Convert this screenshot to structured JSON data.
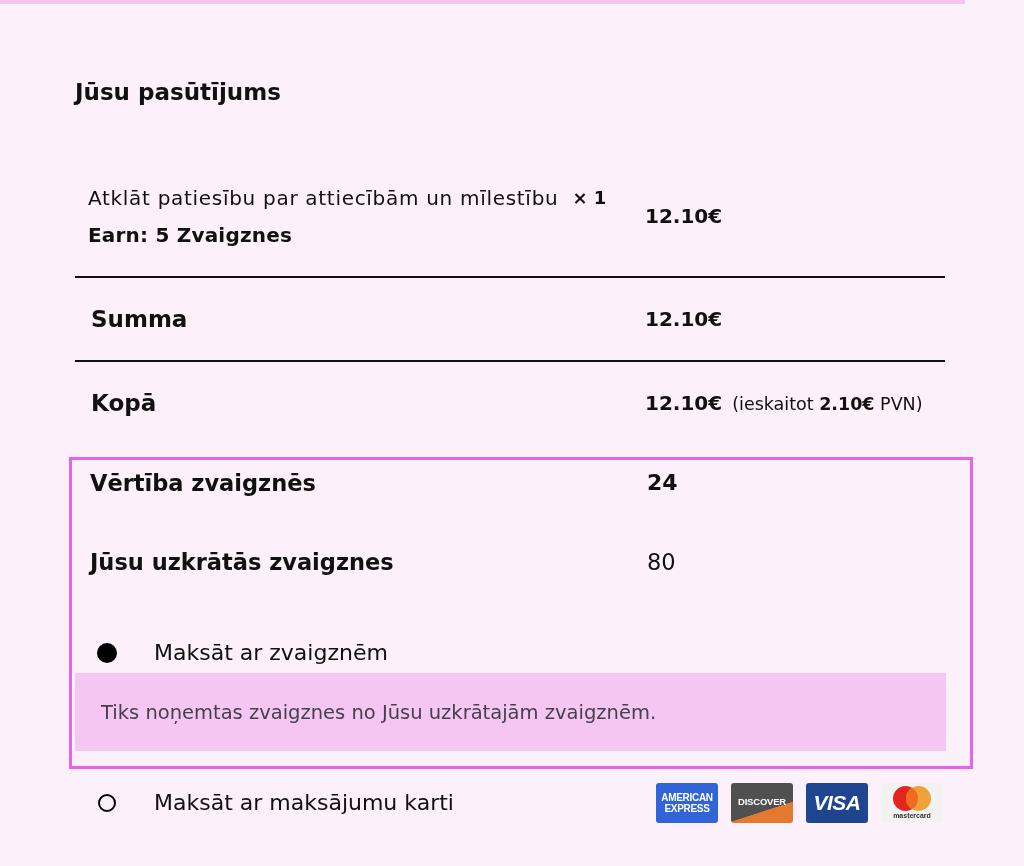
{
  "heading": "Jūsu pasūtījums",
  "items": [
    {
      "name": "Atklāt patiesību par attiecībām un mīlestību",
      "quantity": "× 1",
      "earn": "Earn: 5 Zvaigznes",
      "price": "12.10€"
    }
  ],
  "subtotal": {
    "label": "Summa",
    "value": "12.10€"
  },
  "total": {
    "label": "Kopā",
    "value": "12.10€",
    "tax_note": "(ieskaitot **2.10€** PVN)"
  },
  "star_payment": {
    "rows": [
      {
        "label": "Vērtība zvaigznēs",
        "value": "24",
        "kind": "cost"
      },
      {
        "label": "Jūsu uzkrātās zvaigznes",
        "value": "80",
        "kind": "balance"
      }
    ],
    "option": {
      "label": "Maksāt ar zvaigznēm",
      "selected": true,
      "notice": "Tiks noņemtas zvaigznes no Jūsu uzkrātajām zvaigznēm."
    }
  },
  "card_payment": {
    "label": "Maksāt ar maksājumu karti",
    "selected": false,
    "cards": [
      {
        "kind": "amex",
        "text": "AMERICAN EXPRESS"
      },
      {
        "kind": "discover",
        "text": "DISCOVER"
      },
      {
        "kind": "visa",
        "text": "VISA"
      },
      {
        "kind": "mastercard",
        "text": "mastercard"
      }
    ]
  }
}
